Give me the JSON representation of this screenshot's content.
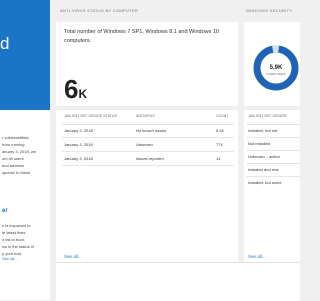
{
  "left_tile": {
    "partial_text": "d"
  },
  "left_panel": {
    "lines": [
      "r vulnerabilities",
      "from running",
      "anuary 3, 2018, we",
      "om all users",
      "and address",
      "sponse to these"
    ],
    "lines2": [
      "n is important to",
      "te latest fixes",
      "ir fail to boot.",
      "ws in the status of",
      "p your end"
    ],
    "heading": "er",
    "see_all": "See all..."
  },
  "middle": {
    "header": "ANTI-VIRUS STATUS BY COMPUTER",
    "description": "Total number of Windows 7 SP1, Windows 8.1 and Windows 10 computers.",
    "big_number": "6",
    "big_number_unit": "K",
    "columns": [
      "JAN 2017 SEC UPDATE STATUS",
      "ANTIVIRUS",
      "COUNT"
    ],
    "rows": [
      {
        "date": "January 3, 2018",
        "antivirus": "No known issues",
        "count": "5.1K"
      },
      {
        "date": "January 3, 2018",
        "antivirus": "Unknown",
        "count": "774"
      },
      {
        "date": "January 3, 2018",
        "antivirus": "Issues reported",
        "count": "14"
      }
    ],
    "see_all": "See all..."
  },
  "right": {
    "header": "WINDOWS SECURITY",
    "donut_value": "5.9K",
    "donut_label": "COMPUTERS",
    "column": "JAN 2017 SEC UPDATE",
    "rows": [
      "Installed, but not",
      "Not installed",
      "Unknown – action",
      "Installed and rest",
      "Installed, but some"
    ],
    "see_all": "See all..."
  },
  "colors": {
    "accent": "#1a74c8",
    "donut_ring": "#1f63b6"
  }
}
